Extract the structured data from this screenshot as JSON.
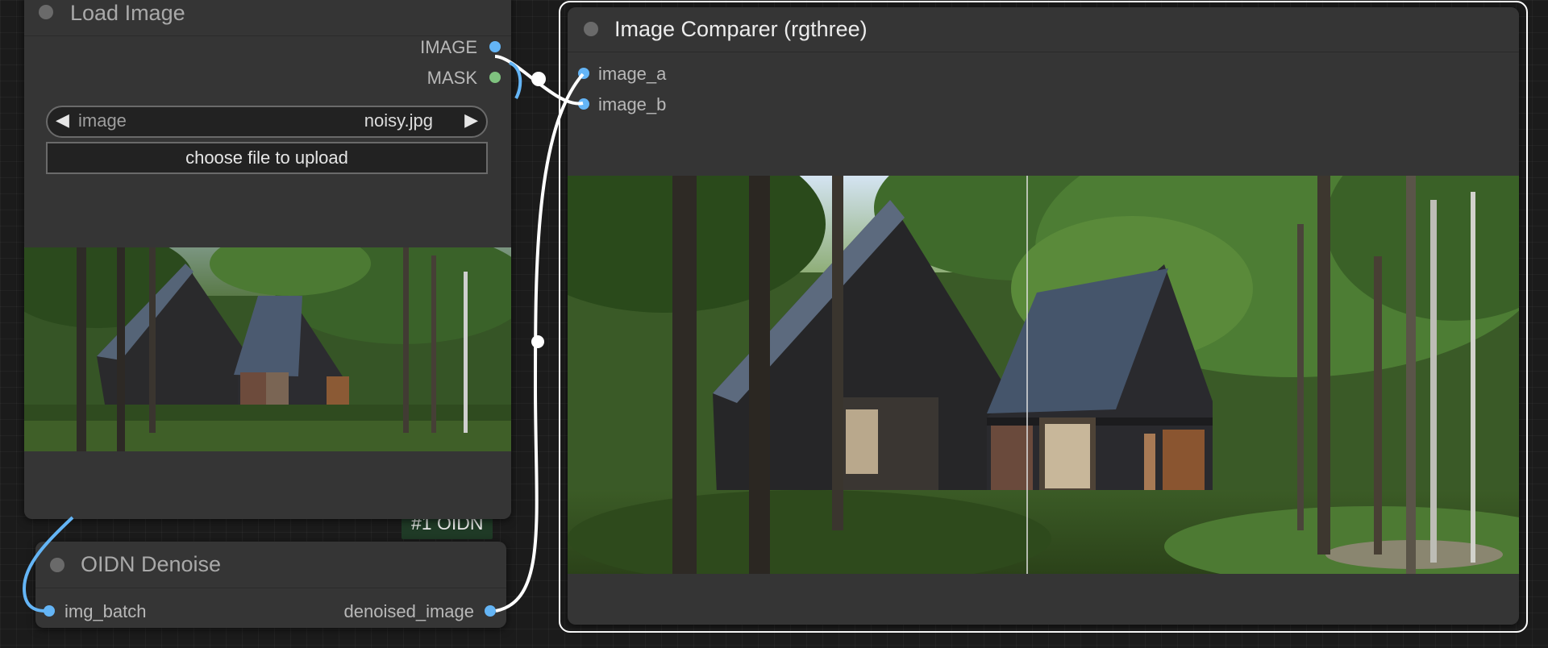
{
  "nodes": {
    "load_image": {
      "title": "Load Image",
      "outputs": [
        {
          "label": "IMAGE",
          "color": "#64b5f6"
        },
        {
          "label": "MASK",
          "color": "#7fc27f"
        }
      ],
      "image_widget": {
        "name": "image",
        "value": "noisy.jpg",
        "prev_icon": "◀",
        "next_icon": "▶"
      },
      "upload_button": "choose file to upload"
    },
    "oidn_denoise": {
      "title": "OIDN Denoise",
      "badge": "#1 OIDN",
      "input": "img_batch",
      "output": "denoised_image"
    },
    "image_comparer": {
      "title": "Image Comparer (rgthree)",
      "inputs": [
        "image_a",
        "image_b"
      ]
    }
  },
  "colors": {
    "canvas": "#1b1b1b",
    "node_body": "#353535",
    "image_slot": "#64b5f6",
    "mask_slot": "#7fc27f",
    "badge": "#1f3a26",
    "selection_outline": "#ffffff",
    "wire": "#ffffff"
  },
  "icons": [
    "node-collapse-dot",
    "arrow-left-icon",
    "arrow-right-icon"
  ]
}
